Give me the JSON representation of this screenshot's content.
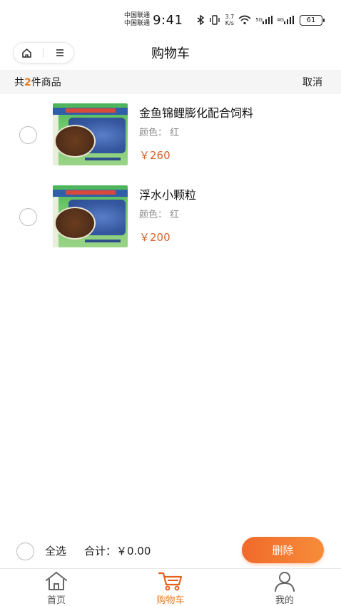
{
  "status_bar": {
    "carrier_1": "中国联通",
    "carrier_2": "中国联通",
    "time": "9:41",
    "speed_value": "3.7",
    "speed_unit": "K/s",
    "signal_1_label": "5G",
    "signal_2_label": "4G",
    "battery": "61"
  },
  "header": {
    "title": "购物车",
    "home_icon": "home-icon",
    "menu_icon": "menu-icon"
  },
  "summary": {
    "prefix": "共",
    "count": "2",
    "suffix": "件商品",
    "cancel": "取消"
  },
  "cart": {
    "items": [
      {
        "name": "金鱼锦鲤膨化配合饲料",
        "spec": "颜色： 红",
        "price": "￥260"
      },
      {
        "name": "浮水小颗粒",
        "spec": "颜色： 红",
        "price": "￥200"
      }
    ]
  },
  "footer": {
    "select_all": "全选",
    "total": "合计：￥0.00",
    "delete": "删除"
  },
  "tabs": [
    {
      "label": "首页",
      "icon": "home-icon"
    },
    {
      "label": "购物车",
      "icon": "cart-icon"
    },
    {
      "label": "我的",
      "icon": "user-icon"
    }
  ],
  "colors": {
    "accent": "#e87a1e",
    "price": "#d4642a",
    "delete_button": "#f06a2a"
  }
}
